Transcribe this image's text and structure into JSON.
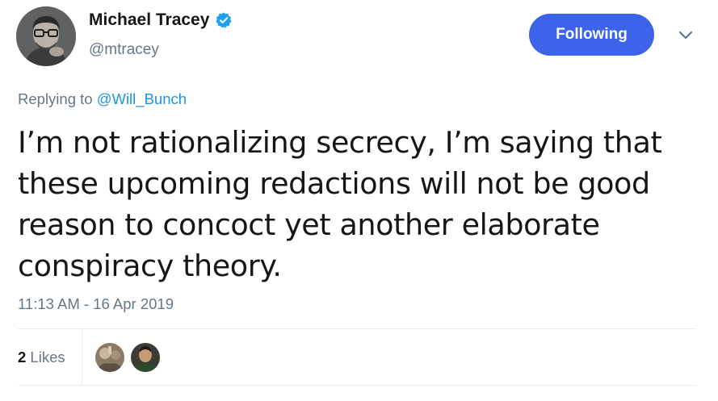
{
  "author": {
    "name": "Michael Tracey",
    "handle": "@mtracey",
    "verified": true
  },
  "follow_button": {
    "label": "Following"
  },
  "reply": {
    "prefix": "Replying to ",
    "target": "@Will_Bunch"
  },
  "tweet": {
    "text": "I’m not rationalizing secrecy, I’m saying that these upcoming redactions will not be good reason to concoct yet another elaborate conspiracy theory.",
    "timestamp": "11:13 AM - 16 Apr 2019"
  },
  "stats": {
    "likes_count": "2",
    "likes_label": " Likes"
  },
  "icons": {
    "verified": "verified-badge-icon",
    "chevron": "chevron-down-icon"
  },
  "colors": {
    "follow_button_bg": "#3d63ea",
    "link": "#1b95e0",
    "secondary_text": "#657786",
    "verified": "#1da1f2"
  }
}
